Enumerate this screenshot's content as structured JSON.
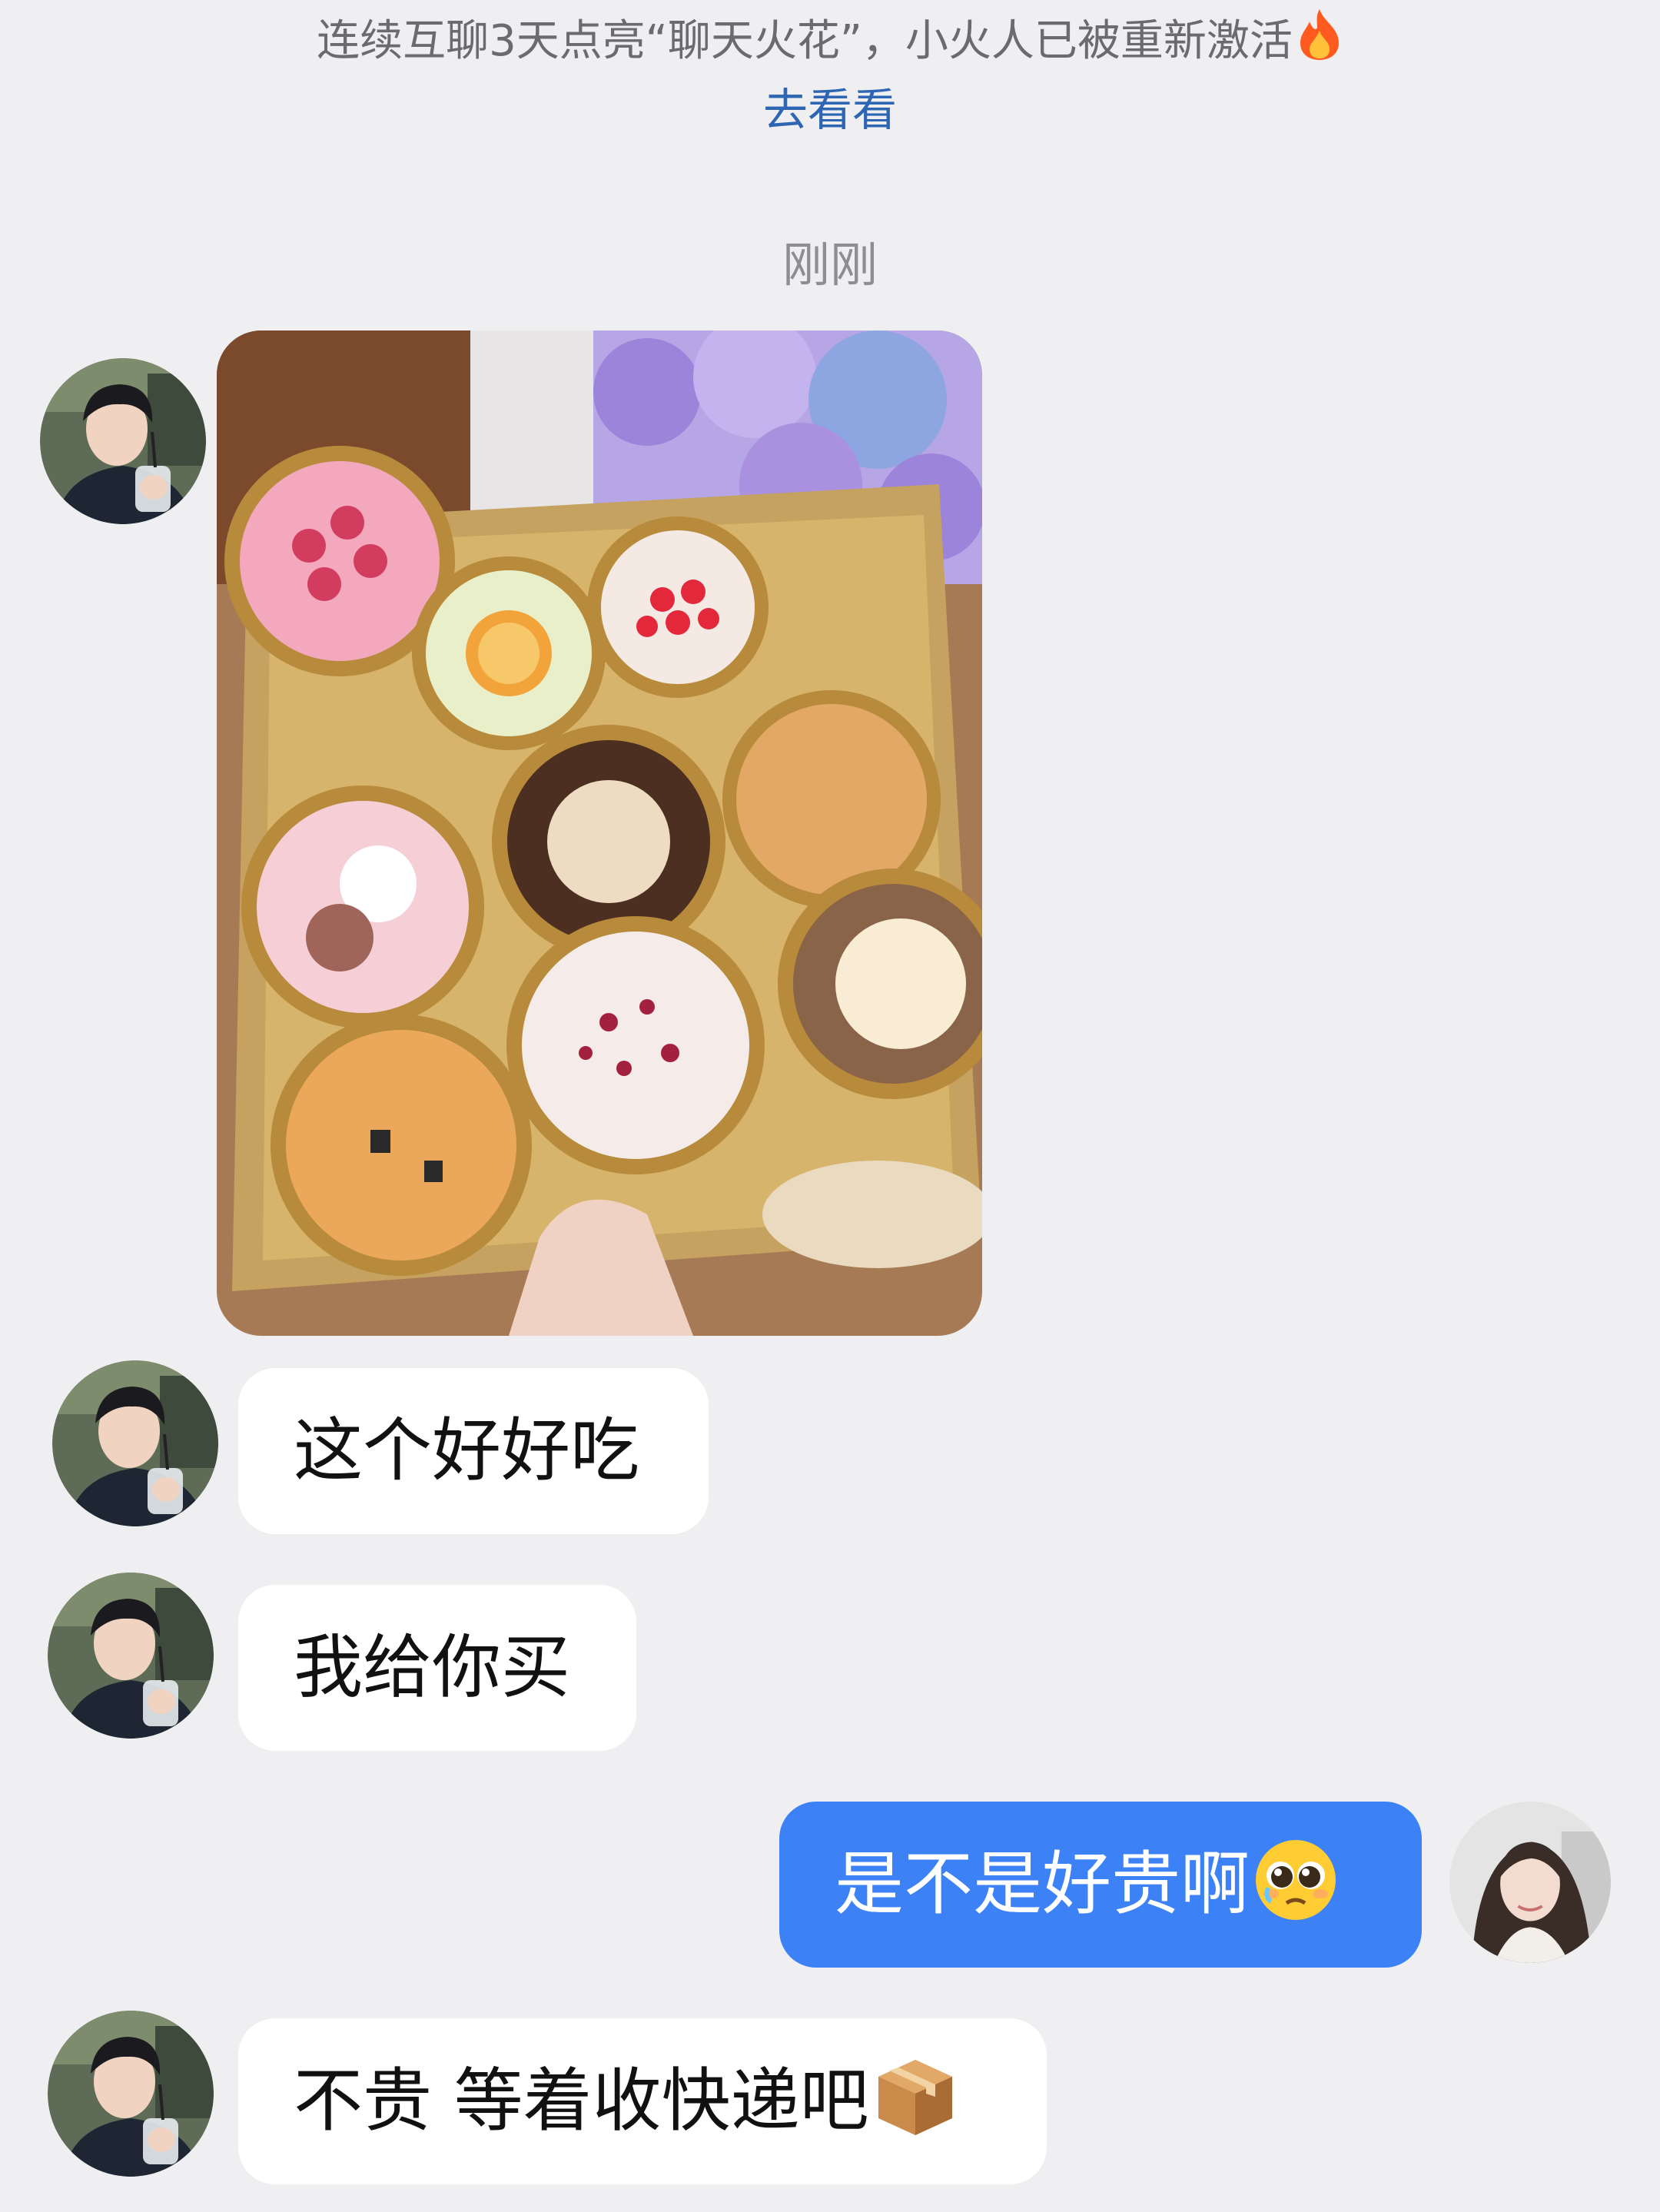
{
  "system_notice": {
    "text": "连续互聊3天点亮“聊天火花”，小火人已被重新激活",
    "icon": "fire-icon",
    "link_label": "去看看"
  },
  "timestamp": "刚刚",
  "colors": {
    "background": "#efeff1",
    "incoming_bubble": "#ffffff",
    "outgoing_bubble": "#3c82f6",
    "link": "#2f66b3"
  },
  "messages": [
    {
      "sender": "contact",
      "type": "image",
      "image_description": "photo-of-assorted-mini-cakes-in-gold-tins"
    },
    {
      "sender": "contact",
      "type": "text",
      "text": "这个好好吃"
    },
    {
      "sender": "contact",
      "type": "text",
      "text": "我给你买"
    },
    {
      "sender": "me",
      "type": "text",
      "text": "是不是好贵啊",
      "emoji": "pleading-face-icon"
    },
    {
      "sender": "contact",
      "type": "text",
      "text": "不贵 等着收快递吧",
      "emoji": "package-icon"
    }
  ]
}
